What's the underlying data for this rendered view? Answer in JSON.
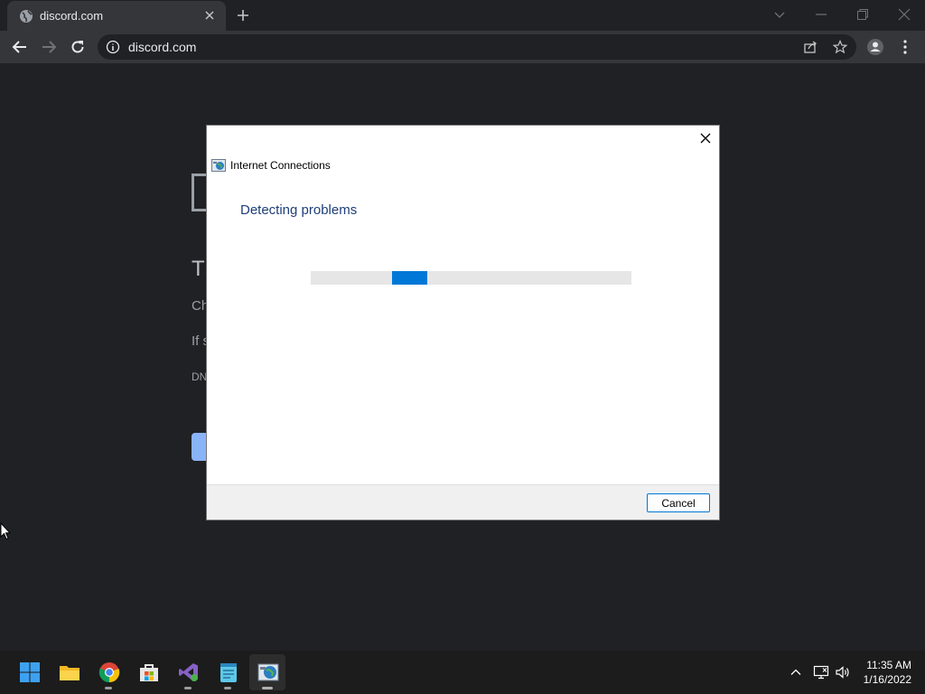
{
  "browser": {
    "tab_title": "discord.com",
    "url": "discord.com"
  },
  "page_behind": {
    "heading_partial": "Th",
    "line1_partial": "Ch",
    "line2_partial": "If s",
    "code_partial": "DN"
  },
  "dialog": {
    "app_title": "Internet Connections",
    "heading": "Detecting problems",
    "progress_indeterminate": true,
    "cancel_label": "Cancel"
  },
  "taskbar": {
    "apps": [
      "windows-start-icon",
      "file-explorer-icon",
      "chrome-icon",
      "store-icon",
      "visual-studio-icon",
      "notepad-icon",
      "network-troubleshooter-icon"
    ],
    "clock_time": "11:35 AM",
    "clock_date": "1/16/2022"
  },
  "colors": {
    "accent": "#0078d7",
    "dialog_heading": "#1e3f78",
    "browser_bg": "#202124",
    "toolbar_bg": "#35363a"
  }
}
